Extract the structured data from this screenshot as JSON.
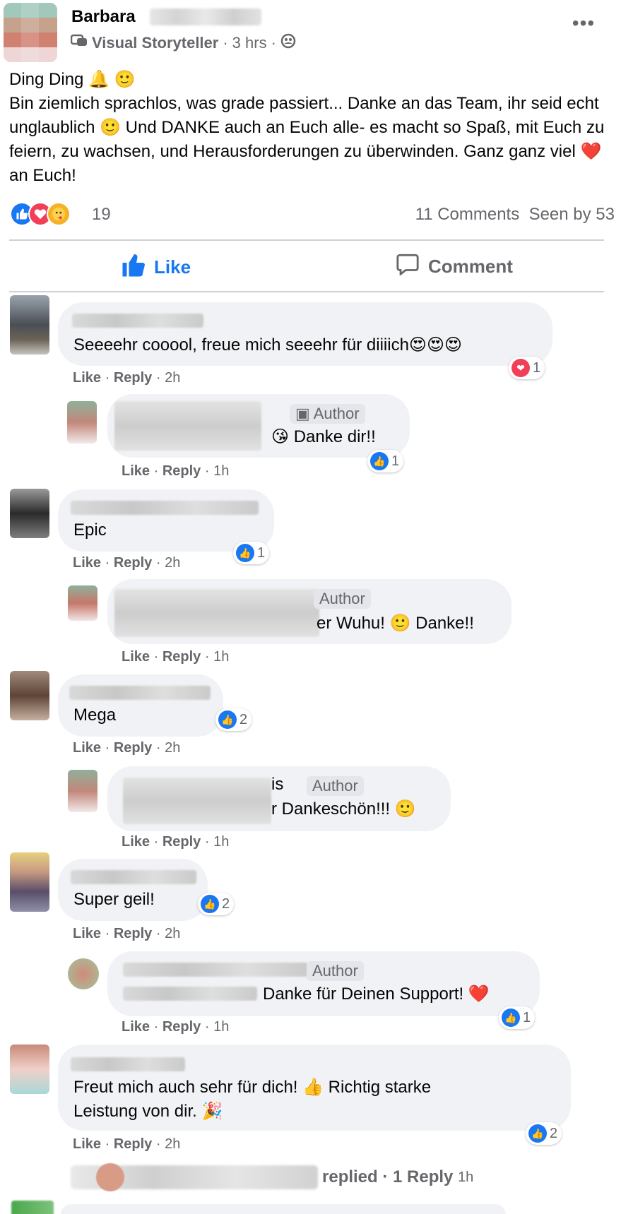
{
  "post": {
    "author_first": "Barbara",
    "role": "Visual Storyteller",
    "time": "3 hrs",
    "sep": "·",
    "text_line1": "Ding Ding 🔔 🙂",
    "text_body": "Bin ziemlich sprachlos, was grade passiert... Danke an das Team, ihr seid echt unglaublich 🙂 Und DANKE auch an Euch alle- es macht so Spaß, mit Euch zu feiern, zu wachsen, und Herausforderungen zu überwinden. Ganz ganz viel ❤️ an Euch!",
    "reaction_count": "19",
    "comments": "11 Comments",
    "seen": "Seen by 53"
  },
  "actions": {
    "like": "Like",
    "comment": "Comment"
  },
  "comment_actions": {
    "like": "Like",
    "reply": "Reply",
    "sep": "·"
  },
  "comments": [
    {
      "text": "Seeeehr cooool, freue mich seeehr für diiiich😍😍😍",
      "time": "2h",
      "react": "1"
    },
    {
      "text": "😘 Danke dir!!",
      "badge": "Author",
      "time": "1h",
      "react": "1"
    },
    {
      "text": "Epic",
      "time": "2h",
      "react": "1"
    },
    {
      "text": "er Wuhu! 🙂 Danke!!",
      "badge": "Author",
      "time": "1h"
    },
    {
      "text": "Mega",
      "time": "2h",
      "react": "2"
    },
    {
      "text": "r Dankeschön!!! 🙂",
      "name_tail": "is",
      "badge": "Author",
      "time": "1h"
    },
    {
      "text": "Super geil!",
      "time": "2h",
      "react": "2"
    },
    {
      "text": "Danke für Deinen Support! ❤️",
      "badge": "Author",
      "time": "1h",
      "react": "1"
    },
    {
      "text_line1": "Freut mich auch sehr für dich! 👍 Richtig starke",
      "text_line2": "Leistung von dir. 🎉",
      "time": "2h",
      "react": "2"
    }
  ],
  "replied": {
    "label": "replied · 1 Reply",
    "time": "1h"
  },
  "colors": {
    "accent": "#1877f2",
    "love": "#f33e58",
    "muted": "#65676b",
    "bubble": "#f0f2f5"
  },
  "icons": [
    "visual-storyteller-icon",
    "friends-audience-icon",
    "more-icon",
    "like-reaction-icon",
    "love-reaction-icon",
    "care-reaction-icon",
    "like-thumb-icon",
    "comment-icon"
  ]
}
